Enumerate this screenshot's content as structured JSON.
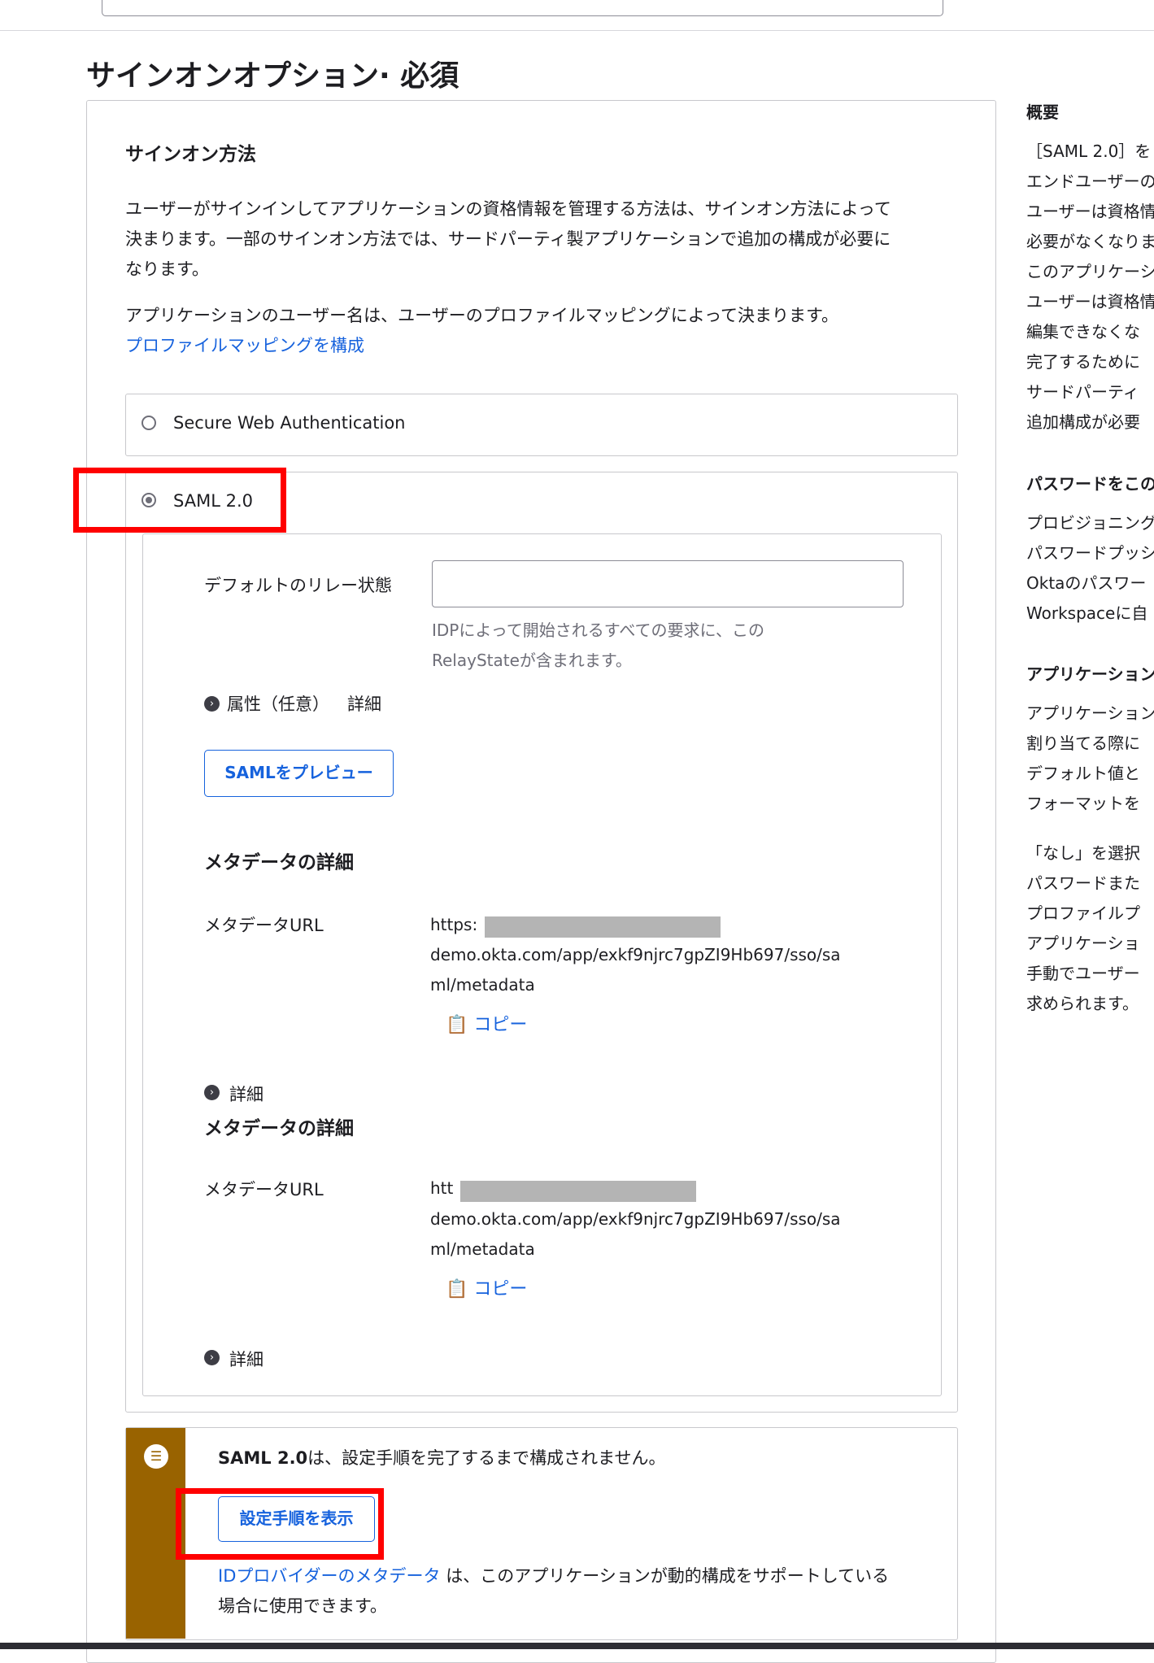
{
  "page": {
    "title": "サインオンオプション· 必須"
  },
  "signon": {
    "heading": "サインオン方法",
    "description_lines": [
      "ユーザーがサインインしてアプリケーションの資格情報を管理する方法は、サインオン方法によって",
      "決まります。一部のサインオン方法では、サードパーティ製アプリケーションで追加の構成が必要に",
      "なります。"
    ],
    "username_note": "アプリケーションのユーザー名は、ユーザーのプロファイルマッピングによって決まります。",
    "profile_mapping_link": "プロファイルマッピングを構成",
    "options": [
      {
        "label": "Secure Web Authentication",
        "selected": false
      },
      {
        "label": "SAML 2.0",
        "selected": true
      }
    ]
  },
  "saml": {
    "relay_state_label": "デフォルトのリレー状態",
    "relay_state_value": "",
    "relay_state_hint_lines": [
      "IDPによって開始されるすべての要求に、この",
      "RelayStateが含まれます。"
    ],
    "attributes_label": "属性（任意）",
    "attributes_link": "詳細",
    "preview_button": "SAMLをプレビュー",
    "metadata_sections": [
      {
        "heading": "メタデータの詳細",
        "url_label": "メタデータURL",
        "url_prefix": "https:",
        "url_line2": "demo.okta.com/app/exkf9njrc7gpZI9Hb697/sso/sa",
        "url_line3": "ml/metadata",
        "copy_label": "コピー",
        "details_label": "詳細"
      },
      {
        "heading": "メタデータの詳細",
        "url_label": "メタデータURL",
        "url_prefix": "htt",
        "url_line2": "demo.okta.com/app/exkf9njrc7gpZI9Hb697/sso/sa",
        "url_line3": "ml/metadata",
        "copy_label": "コピー",
        "details_label": "詳細"
      }
    ]
  },
  "callout": {
    "message_bold": "SAML 2.0",
    "message_rest": "は、設定手順を完了するまで構成されません。",
    "setup_button": "設定手順を表示",
    "idp_link": "IDプロバイダーのメタデータ",
    "idp_rest_line1": " は、このアプリケーションが動的構成をサポートしている",
    "idp_rest_line2": "場合に使用できます。"
  },
  "aside": {
    "overview_heading": "概要",
    "overview_lines": [
      "［SAML 2.0］を",
      "エンドユーザーの",
      "ユーザーは資格情",
      "必要がなくなりま",
      "このアプリケーシ",
      "ユーザーは資格情",
      "編集できなくな",
      "完了するために",
      "サードパーティ",
      "追加構成が必要"
    ],
    "password_heading": "パスワードをこの",
    "password_lines": [
      "プロビジョニング",
      "パスワードプッシ",
      "Oktaのパスワー",
      "Workspaceに自"
    ],
    "app_heading": "アプリケーション",
    "app_lines": [
      "アプリケーション",
      "割り当てる際に",
      "デフォルト値と",
      "フォーマットを"
    ],
    "none_lines": [
      "「なし」を選択",
      "パスワードまた",
      "プロファイルプ",
      "アプリケーショ",
      "手動でユーザー",
      "求められます。"
    ]
  },
  "colors": {
    "accent": "#1662dd",
    "highlight": "#ff0000",
    "callout_stripe": "#996300"
  }
}
